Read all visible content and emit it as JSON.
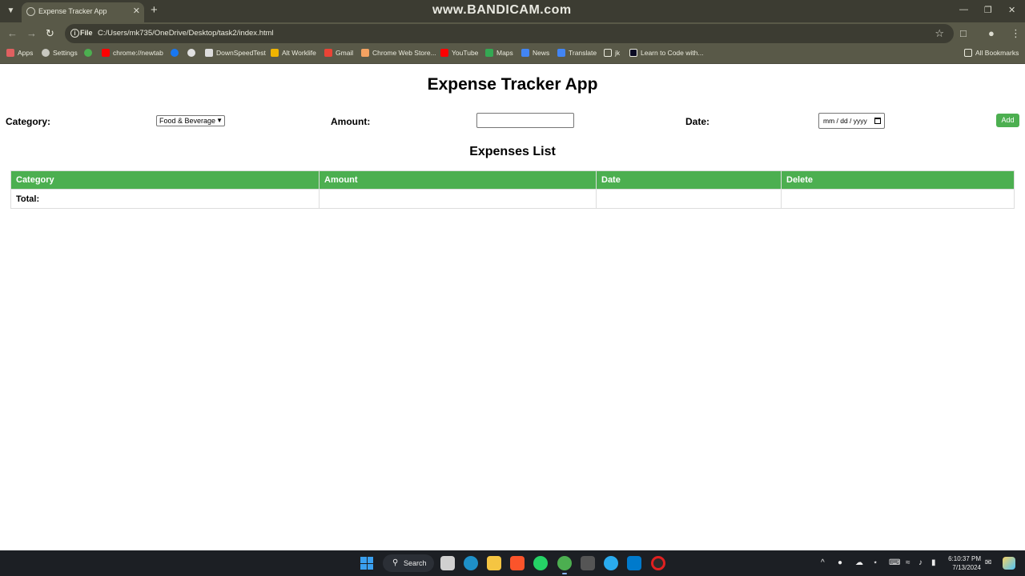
{
  "browser": {
    "tab_title": "Expense Tracker App",
    "watermark": "www.BANDICAM.com",
    "url_scheme": "File",
    "url": "C:/Users/mk735/OneDrive/Desktop/task2/index.html",
    "bookmarks": [
      "Apps",
      "Settings",
      "chrome://newtab",
      "DownSpeedTest",
      "Alt Worklife",
      "Gmail",
      "Chrome Web Store...",
      "YouTube",
      "Maps",
      "News",
      "Translate",
      "jk",
      "Learn to Code with..."
    ],
    "all_bookmarks": "All Bookmarks"
  },
  "page": {
    "title": "Expense Tracker App",
    "form": {
      "category_label": "Category:",
      "category_selected": "Food & Beverage",
      "amount_label": "Amount:",
      "amount_value": "",
      "date_label": "Date:",
      "date_placeholder": "mm / dd / yyyy",
      "add_label": "Add"
    },
    "list_title": "Expenses List",
    "table": {
      "headers": [
        "Category",
        "Amount",
        "Date",
        "Delete"
      ],
      "total_label": "Total:",
      "total_amount": ""
    }
  },
  "taskbar": {
    "search_label": "Search",
    "time": "6:10:37 PM",
    "date": "7/13/2024"
  },
  "colors": {
    "accent_green": "#4caf50",
    "chrome_dark": "#3c3c32",
    "chrome_mid": "#595948",
    "taskbar": "#1c1f24"
  }
}
